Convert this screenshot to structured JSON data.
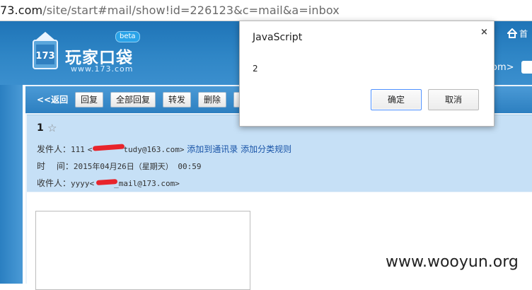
{
  "browser": {
    "url_prefix": "73.com",
    "url_rest": "/site/start#mail/show!id=226123&c=mail&a=inbox"
  },
  "header": {
    "logo_title": "玩家口袋",
    "logo_url": "www.173.com",
    "beta_label": "beta",
    "home_label": "首",
    "gt_label": "om>"
  },
  "toolbar": {
    "back_label": "<<返回",
    "buttons": [
      "回复",
      "全部回复",
      "转发",
      "删除"
    ]
  },
  "mail": {
    "subject": "1",
    "from_label": "发件人：",
    "from_name": "111",
    "from_addr_prefix": "<",
    "from_addr_suffix": "tudy@163.com>",
    "add_contact": "添加到通讯录",
    "add_rule": "添加分类规则",
    "time_label": "时　 间：",
    "time_value": "2015年04月26日（星期天） 00:59",
    "to_label": "收件人：",
    "to_name": "yyyy<",
    "to_addr_suffix": "_mail@173.com>"
  },
  "dialog": {
    "title": "JavaScript",
    "message": "2",
    "ok_label": "确定",
    "cancel_label": "取消",
    "close_glyph": "×"
  },
  "watermark": "www.wooyun.org"
}
